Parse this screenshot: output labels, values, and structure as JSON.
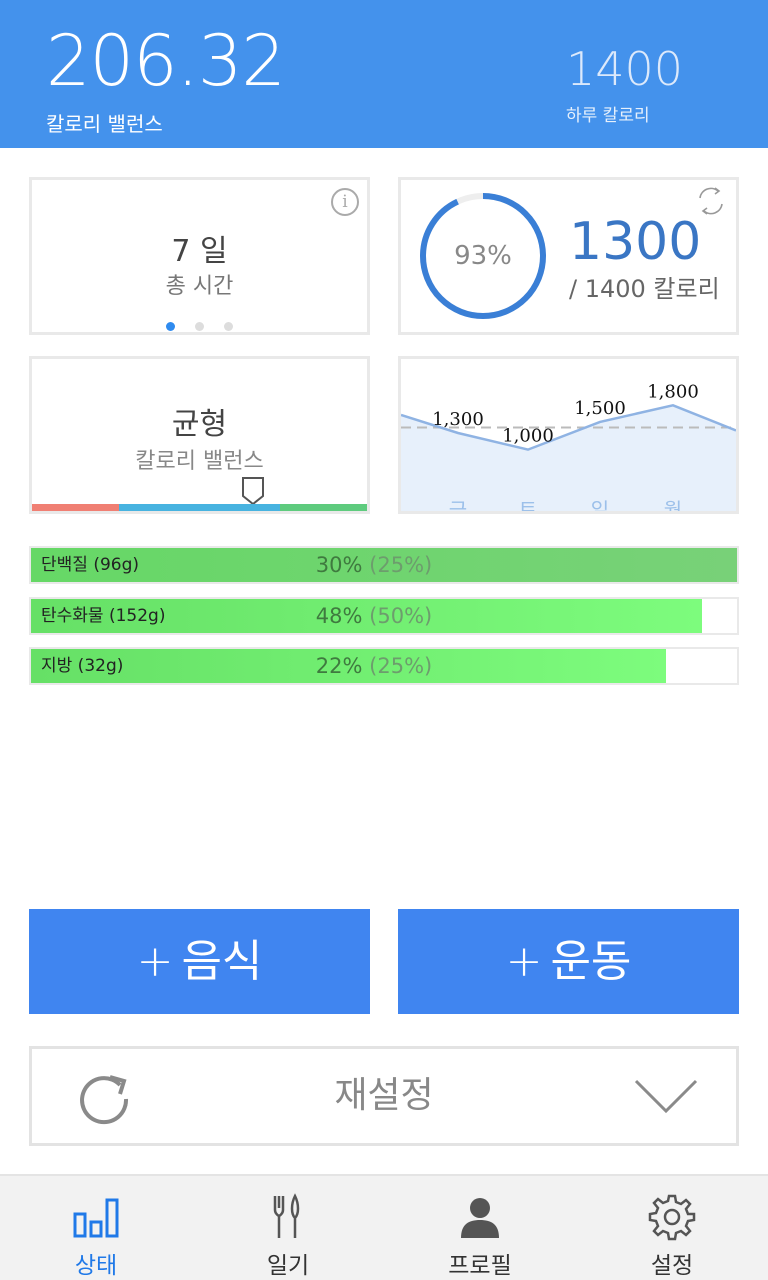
{
  "header": {
    "balance_value": "206.32",
    "balance_label": "칼로리 밸런스",
    "daily_value": "1400",
    "daily_label": "하루 칼로리"
  },
  "cards": {
    "days": {
      "value": "7 일",
      "label": "총 시간",
      "page_count": 3,
      "active_page": 1
    },
    "intake": {
      "percent_label": "93%",
      "percent": 0.93,
      "value": "1300",
      "target": "/ 1400 칼로리"
    },
    "balance_type": {
      "value": "균형",
      "label": "칼로리 밸런스",
      "scale_colors": [
        "#f07f73",
        "#47b3e0",
        "#5ecb7e"
      ],
      "marker_position": 0.66
    },
    "trend": {
      "points": [
        {
          "day": "금",
          "value": 1300,
          "label": "1,300"
        },
        {
          "day": "토",
          "value": 1000,
          "label": "1,000"
        },
        {
          "day": "일",
          "value": 1500,
          "label": "1,500"
        },
        {
          "day": "월",
          "value": 1800,
          "label": "1,800"
        }
      ],
      "reference_value": 1400
    }
  },
  "macros": [
    {
      "name": "단백질 (96g)",
      "percent": "30%",
      "target": "(25%)",
      "fill": 1.0
    },
    {
      "name": "탄수화물 (152g)",
      "percent": "48%",
      "target": "(50%)",
      "fill": 0.95
    },
    {
      "name": "지방 (32g)",
      "percent": "22%",
      "target": "(25%)",
      "fill": 0.9
    }
  ],
  "actions": {
    "food_label": "음식",
    "exercise_label": "운동",
    "plus": "+",
    "reset_label": "재설정"
  },
  "nav": {
    "status": "상태",
    "diary": "일기",
    "profile": "프로필",
    "settings": "설정"
  },
  "colors": {
    "header": "#4492ec",
    "accent": "#4085f0",
    "active_nav": "#2079e8",
    "macro_fill": "#7dfc7d"
  }
}
